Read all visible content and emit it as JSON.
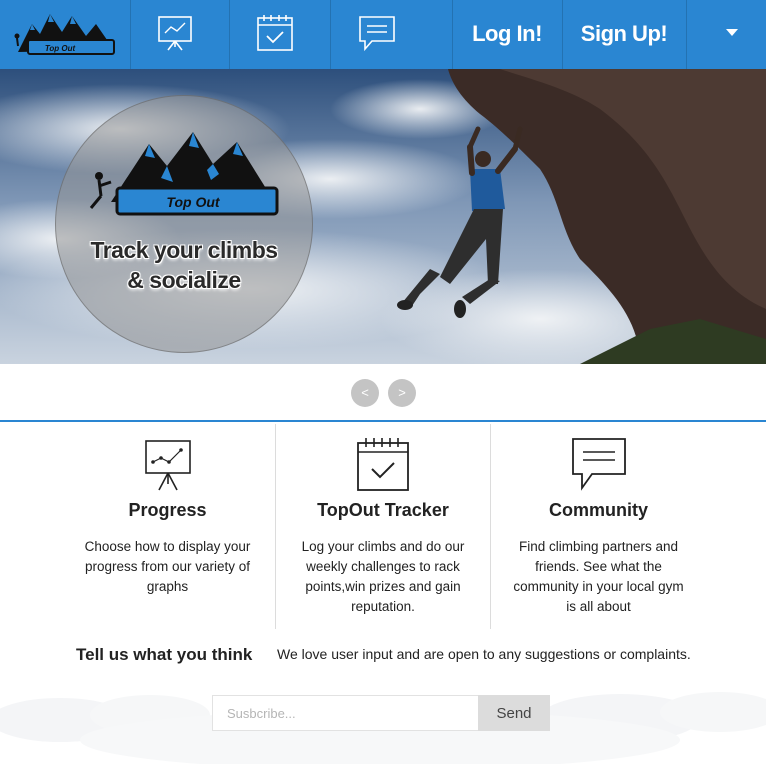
{
  "brand": {
    "logo_text": "Top Out"
  },
  "nav": {
    "items": [
      {
        "icon": "chart-presentation-icon"
      },
      {
        "icon": "calendar-check-icon"
      },
      {
        "icon": "chat-bubble-icon"
      }
    ],
    "login_label": "Log In!",
    "signup_label": "Sign Up!",
    "menu_icon": "caret-down-icon"
  },
  "hero": {
    "badge_logo_text": "Top Out",
    "tagline_line1": "Track your climbs",
    "tagline_line2": "& socialize",
    "prev_label": "<",
    "next_label": ">"
  },
  "features": [
    {
      "icon": "chart-presentation-icon",
      "title": "Progress",
      "lines": [
        "Choose how to display your",
        "progress from our variety of",
        "graphs"
      ]
    },
    {
      "icon": "calendar-check-icon",
      "title": "TopOut Tracker",
      "lines": [
        "Log your climbs and do our",
        "weekly challenges to rack",
        "points,win prizes and gain",
        "reputation."
      ]
    },
    {
      "icon": "chat-bubble-icon",
      "title": "Community",
      "lines": [
        "Find climbing partners and",
        "friends. See what the",
        "community in your local gym",
        "is all about"
      ]
    }
  ],
  "feedback": {
    "title": "Tell us what you think",
    "text": "We love user input and are open to any suggestions or complaints.",
    "input_placeholder": "Susbcribe...",
    "send_label": "Send"
  },
  "colors": {
    "accent": "#2a86d2",
    "button_gray": "#c4c4c4"
  }
}
